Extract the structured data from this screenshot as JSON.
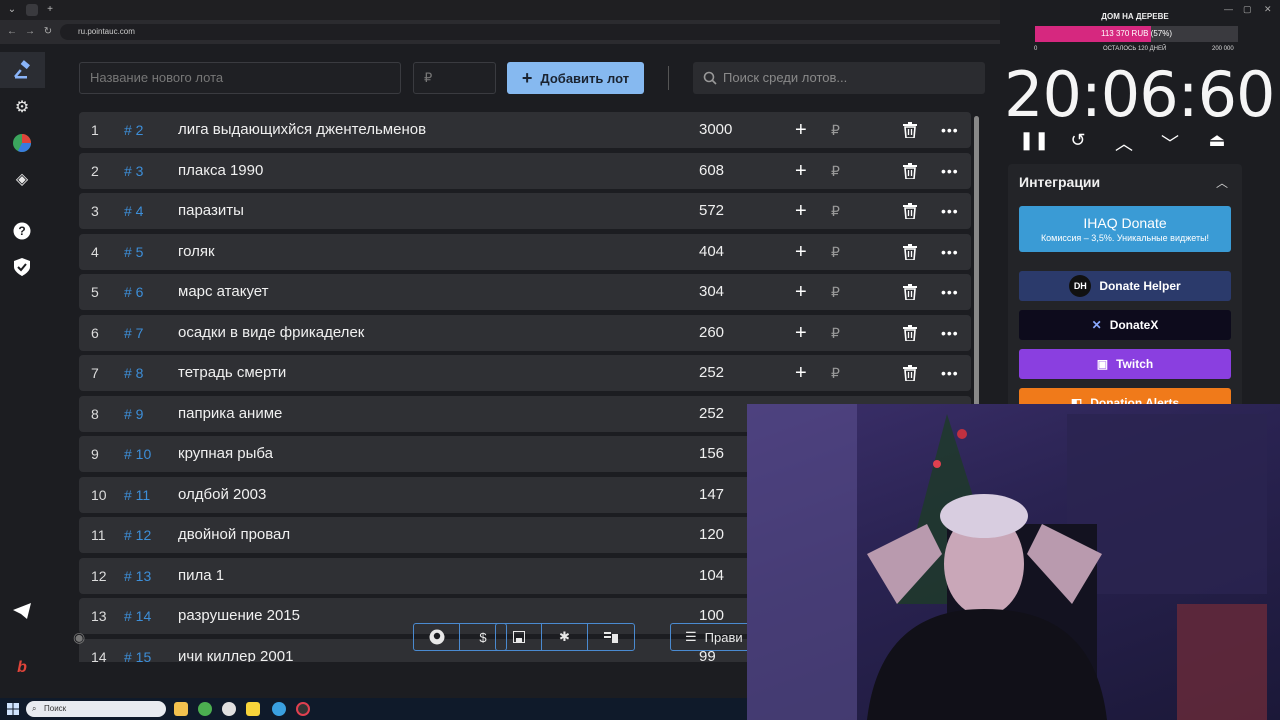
{
  "browser": {
    "url": "ru.pointauc.com"
  },
  "toolbar": {
    "lot_name_placeholder": "Название нового лота",
    "amount_placeholder": "₽",
    "add_button_label": "Добавить лот",
    "search_placeholder": "Поиск среди лотов..."
  },
  "lots": [
    {
      "index": "1",
      "id": "# 2",
      "name": "лига выдающихйся джентельменов",
      "amount": "3000"
    },
    {
      "index": "2",
      "id": "# 3",
      "name": "плакса 1990",
      "amount": "608"
    },
    {
      "index": "3",
      "id": "# 4",
      "name": "паразиты",
      "amount": "572"
    },
    {
      "index": "4",
      "id": "# 5",
      "name": "голяк",
      "amount": "404"
    },
    {
      "index": "5",
      "id": "# 6",
      "name": "марс атакует",
      "amount": "304"
    },
    {
      "index": "6",
      "id": "# 7",
      "name": "осадки в виде фрикаделек",
      "amount": "260"
    },
    {
      "index": "7",
      "id": "# 8",
      "name": "тетрадь смерти",
      "amount": "252"
    },
    {
      "index": "8",
      "id": "# 9",
      "name": "паприка аниме",
      "amount": "252"
    },
    {
      "index": "9",
      "id": "# 10",
      "name": "крупная рыба",
      "amount": "156"
    },
    {
      "index": "10",
      "id": "# 11",
      "name": "олдбой 2003",
      "amount": "147"
    },
    {
      "index": "11",
      "id": "# 12",
      "name": " двойной провал",
      "amount": "120"
    },
    {
      "index": "12",
      "id": "# 13",
      "name": "пила 1",
      "amount": "104"
    },
    {
      "index": "13",
      "id": "# 14",
      "name": "разрушение 2015",
      "amount": "100"
    },
    {
      "index": "14",
      "id": "# 15",
      "name": "ичи киллер 2001",
      "amount": "99"
    }
  ],
  "row_actions": {
    "plus": "+",
    "currency": "₽",
    "more": "•••"
  },
  "bottom": {
    "rules_label": "Прави"
  },
  "goal": {
    "title": "ДОМ НА ДЕРЕВЕ",
    "progress_text": "113 370 RUB (57%)",
    "progress_fraction": 0.57,
    "min_label": "0",
    "remaining_label": "ОСТАЛОСЬ 120 ДНЕЙ",
    "max_label": "200 000",
    "color": "#d6287f"
  },
  "timer": {
    "value": "20:06:60"
  },
  "integrations": {
    "title": "Интеграции",
    "buttons": [
      {
        "label": "IHAQ Donate",
        "sub": "Комиссия – 3,5%. Уникальные виджеты!",
        "color": "#3a9bd5"
      },
      {
        "label": "Donate Helper",
        "color": "#2b3a6b"
      },
      {
        "label": "DonateX",
        "color": "#0d0b1c"
      },
      {
        "label": "Twitch",
        "color": "#8a3fe0"
      },
      {
        "label": "Donation Alerts",
        "color": "#f07a1a"
      }
    ]
  },
  "taskbar": {
    "search_label": "Поиск"
  }
}
